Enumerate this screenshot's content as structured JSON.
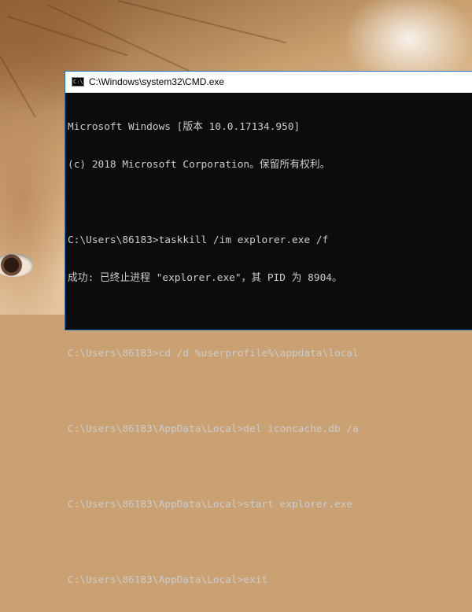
{
  "window": {
    "title": "C:\\Windows\\system32\\CMD.exe",
    "icon": "cmd-icon",
    "icon_glyph": "C:\\"
  },
  "console": {
    "lines": [
      "Microsoft Windows [版本 10.0.17134.950]",
      "(c) 2018 Microsoft Corporation。保留所有权利。",
      "",
      "C:\\Users\\86183>taskkill /im explorer.exe /f",
      "成功: 已终止进程 \"explorer.exe\"，其 PID 为 8904。",
      "",
      "C:\\Users\\86183>cd /d %userprofile%\\appdata\\local",
      "",
      "C:\\Users\\86183\\AppData\\Local>del iconcache.db /a",
      "",
      "C:\\Users\\86183\\AppData\\Local>start explorer.exe",
      "",
      "C:\\Users\\86183\\AppData\\Local>exit"
    ]
  },
  "colors": {
    "console_bg": "#0c0c0c",
    "console_text": "#cccccc",
    "titlebar_bg": "#ffffff",
    "window_border": "#1f6fbf"
  }
}
